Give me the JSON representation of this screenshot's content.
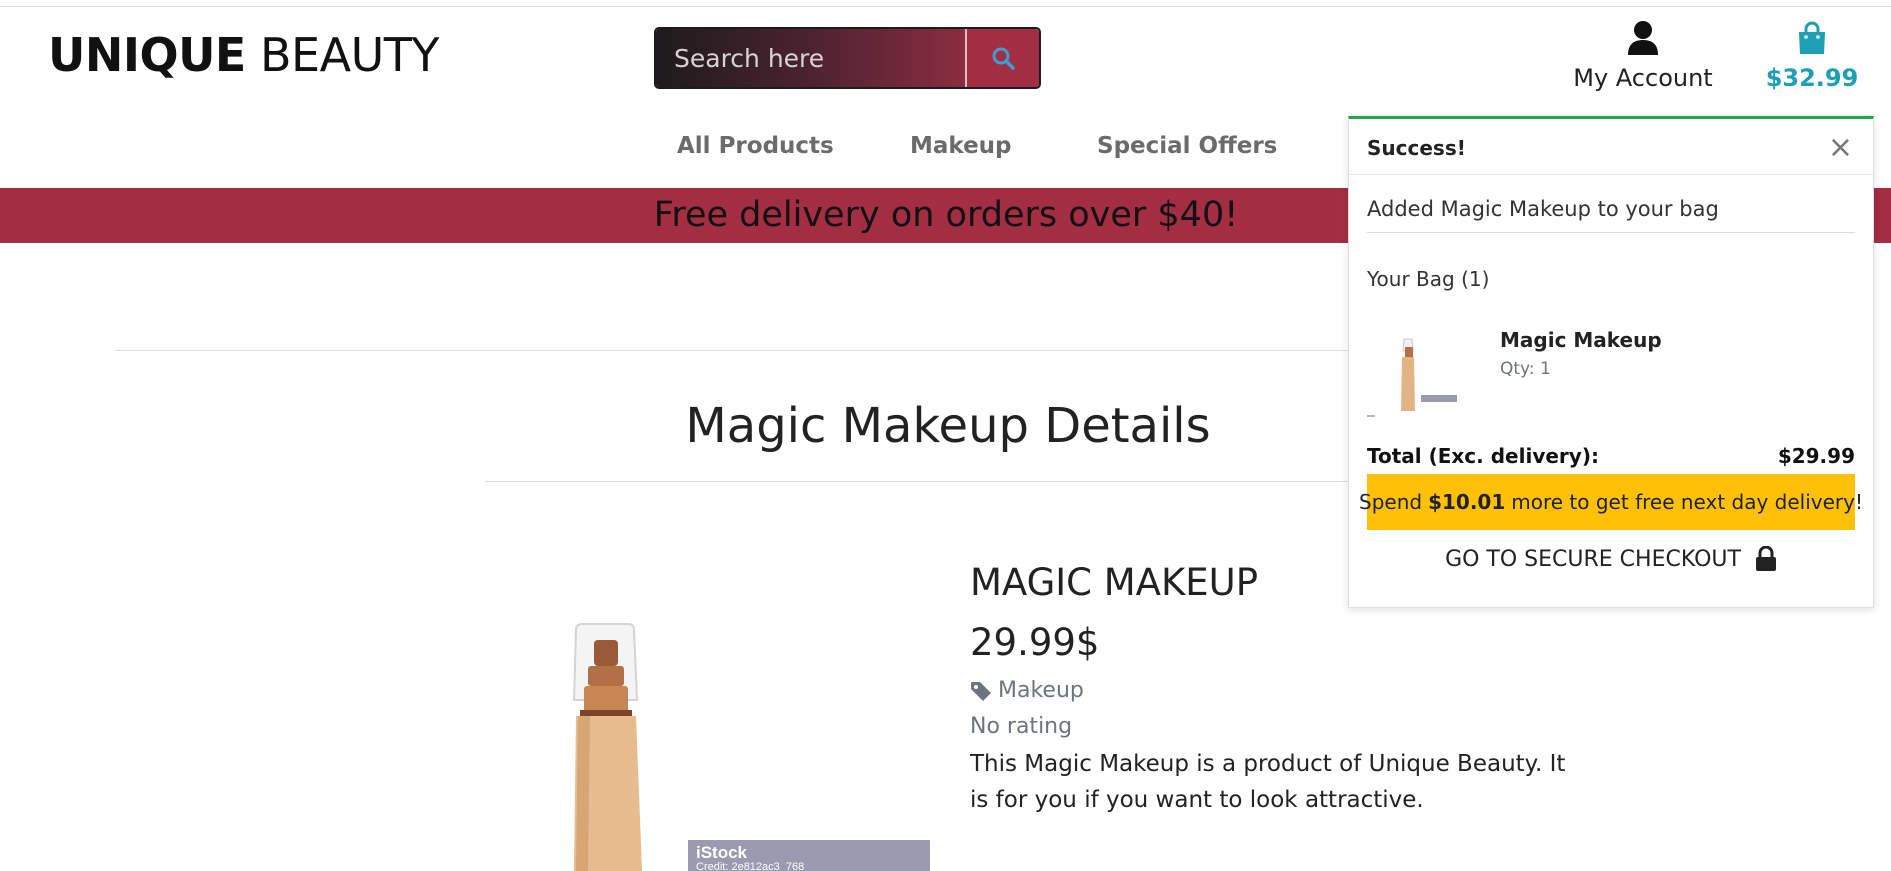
{
  "header": {
    "logo_bold": "UNIQUE",
    "logo_light": "BEAUTY",
    "search_placeholder": "Search here",
    "account_label": "My Account",
    "bag_total": "$32.99",
    "icons": {
      "search": "search-icon",
      "account": "user-icon",
      "bag": "shopping-bag-icon"
    }
  },
  "nav": {
    "items": [
      "All Products",
      "Makeup",
      "Special Offers"
    ]
  },
  "banner": {
    "text": "Free delivery on orders over $40!"
  },
  "page": {
    "title": "Magic Makeup Details"
  },
  "product": {
    "name": "MAGIC MAKEUP",
    "price": "29.99$",
    "category": "Makeup",
    "rating": "No rating",
    "description": "This Magic Makeup is a product of Unique Beauty. It is for you if you want to look attractive.",
    "image_watermark": "iStock",
    "image_credit": "Credit: 2e812ac3_768"
  },
  "toast": {
    "title": "Success!",
    "close_glyph": "×",
    "message": "Added Magic Makeup to your bag",
    "bag_count_label": "Your Bag (1)",
    "item": {
      "name": "Magic Makeup",
      "qty": "Qty: 1"
    },
    "total_label": "Total (Exc. delivery):",
    "total_value": "$29.99",
    "promo_prefix": "Spend",
    "promo_amount": "$10.01",
    "promo_suffix": "more to get free next day delivery!",
    "checkout_label": "GO TO SECURE CHECKOUT"
  },
  "colors": {
    "brand_red": "#a32d43",
    "bag_teal": "#1f9fb5",
    "success_green": "#28a745",
    "promo_yellow": "#ffc107"
  }
}
